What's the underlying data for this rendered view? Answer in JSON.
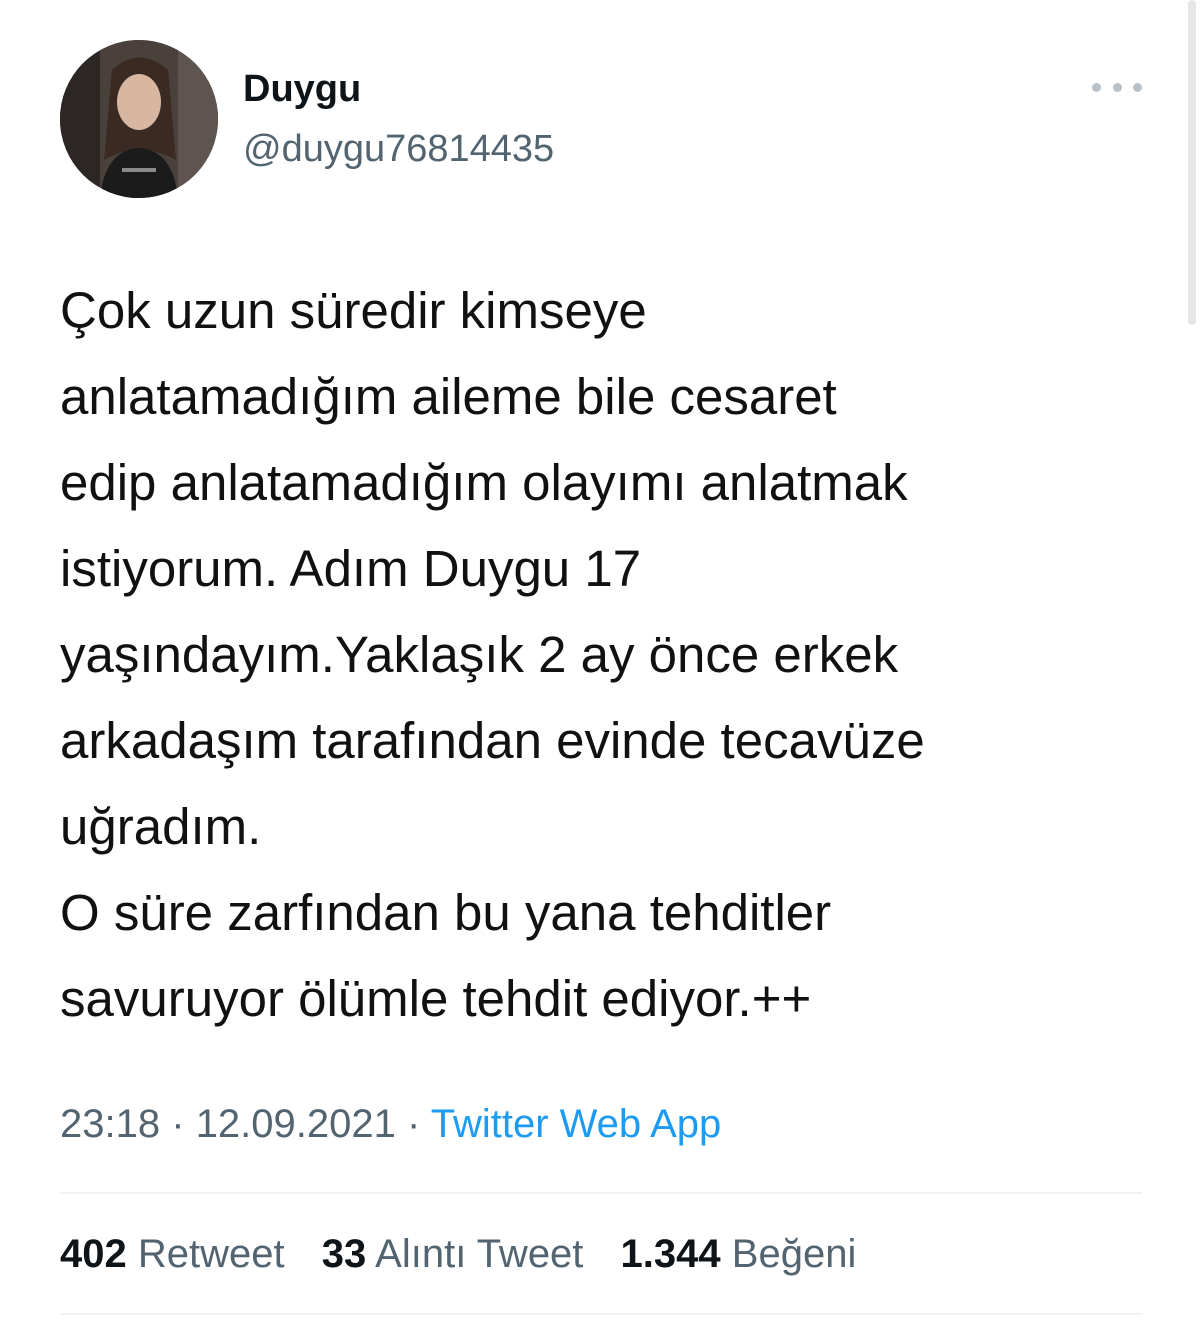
{
  "user": {
    "display_name": "Duygu",
    "handle": "@duygu76814435"
  },
  "icons": {
    "more": "more-dots-icon",
    "avatar": "profile-photo"
  },
  "tweet": {
    "text": "Çok uzun süredir kimseye\nanlatamadığım aileme bile cesaret\nedip anlatamadığım olayımı anlatmak\nistiyorum. Adım Duygu 17\nyaşındayım.Yaklaşık 2 ay önce erkek\narkadaşım tarafından evinde tecavüze\nuğradım.\nO süre zarfından bu yana tehditler\nsavuruyor ölümle tehdit ediyor.++",
    "time": "23:18",
    "date": "12.09.2021",
    "separator": "·",
    "source": "Twitter Web App"
  },
  "stats": {
    "retweets_count": "402",
    "retweets_label": "Retweet",
    "quotes_count": "33",
    "quotes_label": "Alıntı Tweet",
    "likes_count": "1.344",
    "likes_label": "Beğeni"
  },
  "colors": {
    "text_primary": "#0f1419",
    "text_secondary": "#536471",
    "link": "#1d9bf0",
    "divider": "#eff3f4"
  }
}
